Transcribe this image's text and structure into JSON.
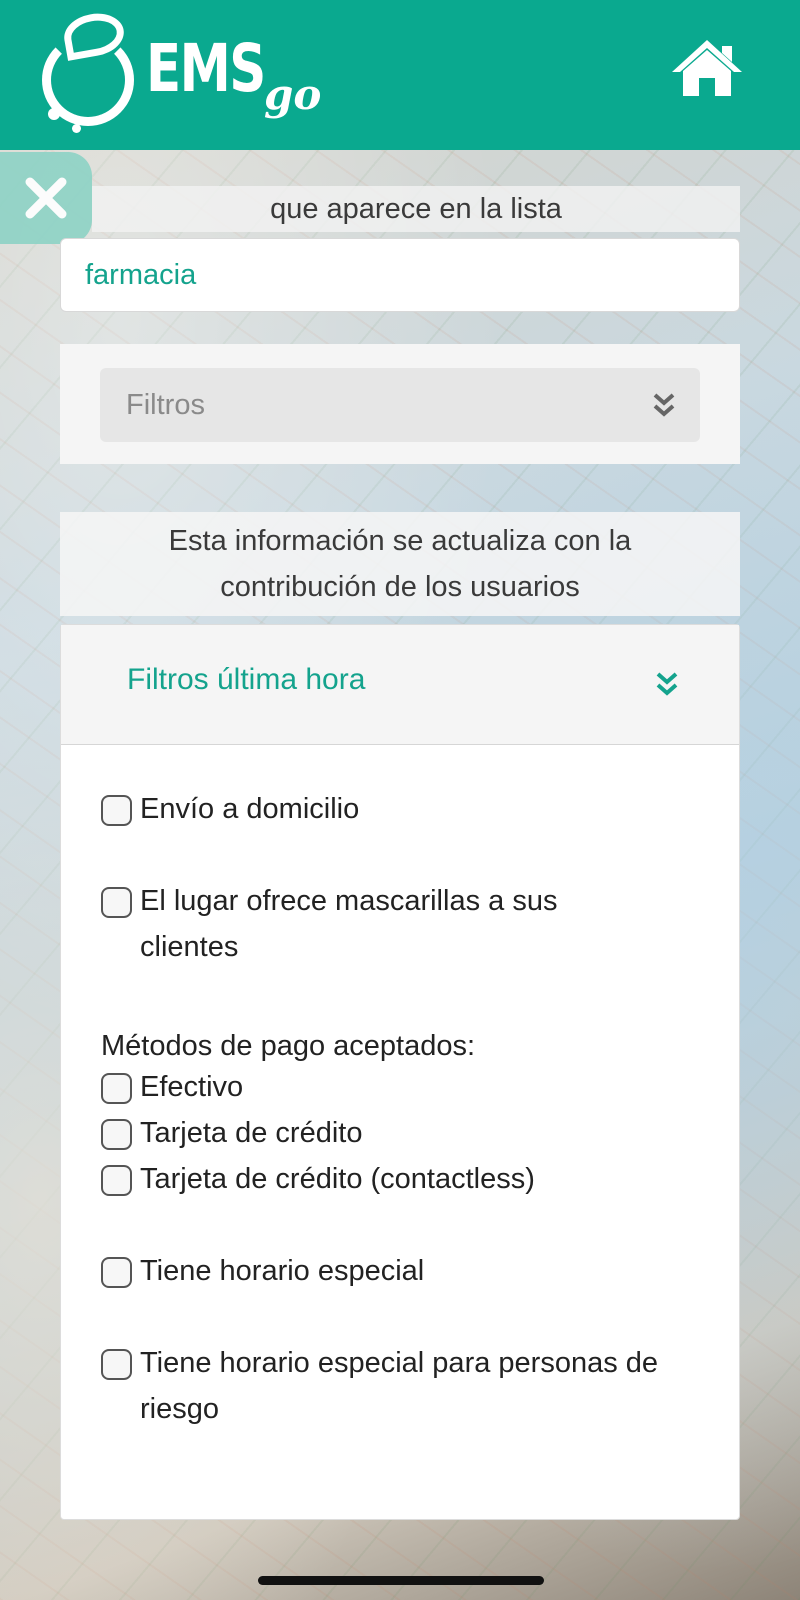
{
  "header": {
    "logo_text": "EMS",
    "logo_suffix": "go",
    "home_icon": "home-icon",
    "background_color": "#0aa98f"
  },
  "close_icon": "close-icon",
  "search": {
    "hint": "que aparece en la lista",
    "value": "farmacia"
  },
  "filters": {
    "selected": "Filtros",
    "icon": "double-chevron-down-icon"
  },
  "info": {
    "line1": "Esta información se actualiza con la",
    "line2": "contribución de los usuarios"
  },
  "last_hour_filters": {
    "title": "Filtros última hora",
    "icon": "double-chevron-down-icon",
    "accent_color": "#14a38d",
    "delivery": "Envío a domicilio",
    "masks_line1": "El lugar ofrece mascarillas a sus",
    "masks_line2": "clientes",
    "payment_label": "Métodos de pago aceptados:",
    "payment_options": [
      "Efectivo",
      "Tarjeta de crédito",
      "Tarjeta de crédito (contactless)"
    ],
    "special_hours": "Tiene horario especial",
    "risk_line1": "Tiene horario especial para personas de",
    "risk_line2": "riesgo"
  }
}
